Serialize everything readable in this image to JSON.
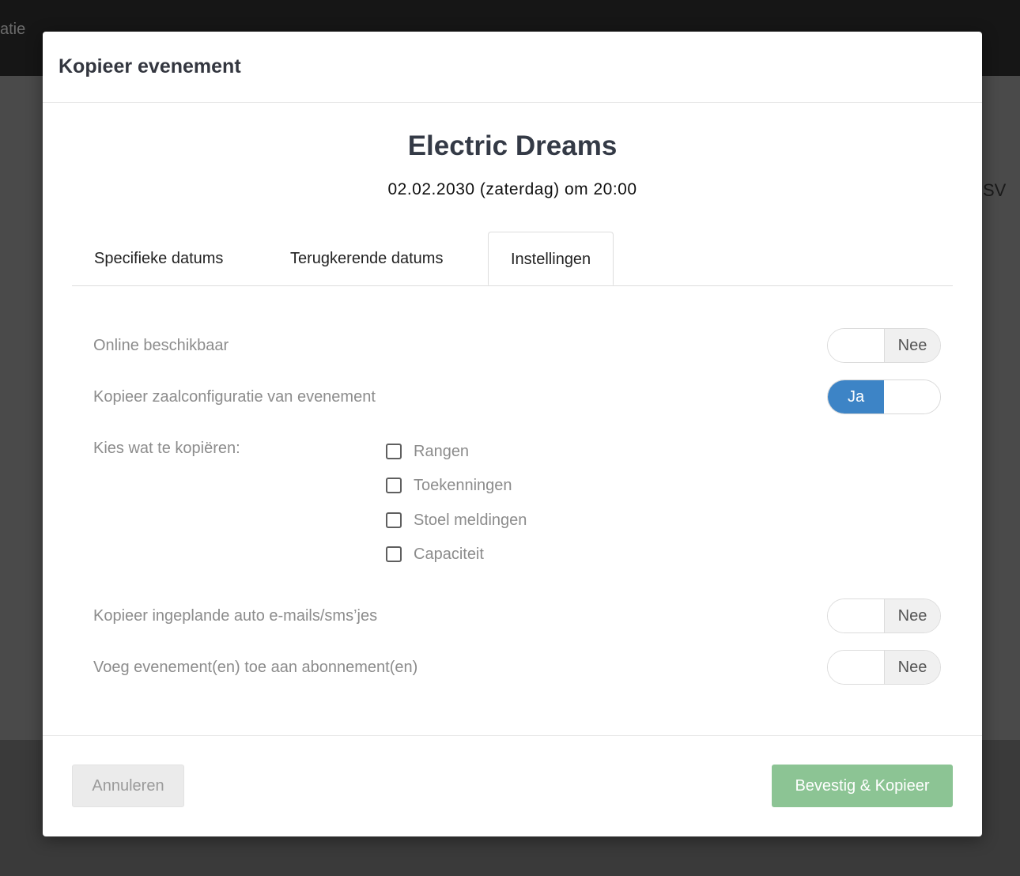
{
  "background": {
    "left_text": "atie",
    "right_text": "SV"
  },
  "modal": {
    "title": "Kopieer evenement",
    "event_name": "Electric Dreams",
    "event_date": "02.02.2030 (zaterdag) om 20:00",
    "tabs": [
      {
        "label": "Specifieke datums",
        "active": false
      },
      {
        "label": "Terugkerende datums",
        "active": false
      },
      {
        "label": "Instellingen",
        "active": true
      }
    ],
    "settings": {
      "online_available": {
        "label": "Online beschikbaar",
        "value": "Nee"
      },
      "copy_hall_config": {
        "label": "Kopieer zaalconfiguratie van evenement",
        "value": "Ja"
      },
      "choose_copy": {
        "label": "Kies wat te kopiëren:",
        "options": [
          {
            "label": "Rangen",
            "checked": false
          },
          {
            "label": "Toekenningen",
            "checked": false
          },
          {
            "label": "Stoel meldingen",
            "checked": false
          },
          {
            "label": "Capaciteit",
            "checked": false
          }
        ]
      },
      "copy_auto_emails": {
        "label": "Kopieer ingeplande auto e-mails/sms’jes",
        "value": "Nee"
      },
      "add_to_subscription": {
        "label": "Voeg evenement(en) toe aan abonnement(en)",
        "value": "Nee"
      }
    },
    "footer": {
      "cancel_label": "Annuleren",
      "confirm_label": "Bevestig & Kopieer"
    }
  },
  "colors": {
    "accent_blue": "#3d84c6",
    "confirm_green": "#8cc494",
    "title_text": "#343a46"
  },
  "icons": {
    "checkbox": "empty-checkbox-icon"
  }
}
